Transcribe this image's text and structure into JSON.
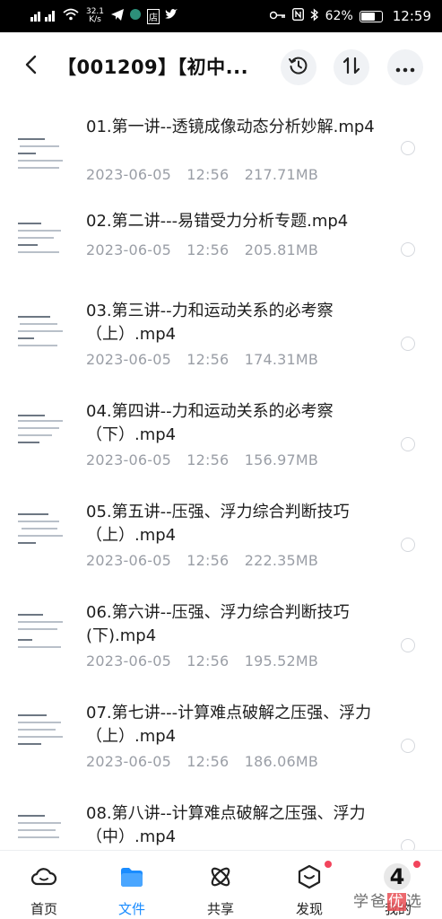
{
  "status_bar": {
    "network_speed": "32.1\nK/s",
    "network_speed_value": "32.1",
    "network_speed_unit": "K/s",
    "app_badge": "店",
    "battery": "62%",
    "time": "12:59"
  },
  "header": {
    "title": "【001209】【初中...",
    "icons": [
      "back-arrow-icon",
      "history-icon",
      "sort-icon",
      "more-icon"
    ]
  },
  "files": [
    {
      "name": "01.第一讲--透镜成像动态分析妙解.mp4",
      "date": "2023-06-05",
      "time": "12:56",
      "size": "217.71MB"
    },
    {
      "name": "02.第二讲---易错受力分析专题.mp4",
      "date": "2023-06-05",
      "time": "12:56",
      "size": "205.81MB"
    },
    {
      "name": "03.第三讲--力和运动关系的必考察（上）.mp4",
      "date": "2023-06-05",
      "time": "12:56",
      "size": "174.31MB"
    },
    {
      "name": "04.第四讲--力和运动关系的必考察（下）.mp4",
      "date": "2023-06-05",
      "time": "12:56",
      "size": "156.97MB"
    },
    {
      "name": "05.第五讲--压强、浮力综合判断技巧（上）.mp4",
      "date": "2023-06-05",
      "time": "12:56",
      "size": "222.35MB"
    },
    {
      "name": "06.第六讲--压强、浮力综合判断技巧(下).mp4",
      "date": "2023-06-05",
      "time": "12:56",
      "size": "195.52MB"
    },
    {
      "name": "07.第七讲---计算难点破解之压强、浮力（上）.mp4",
      "date": "2023-06-05",
      "time": "12:56",
      "size": "186.06MB"
    },
    {
      "name": "08.第八讲--计算难点破解之压强、浮力（中）.mp4",
      "date": "",
      "time": "",
      "size": ""
    }
  ],
  "bottom_nav": [
    {
      "label": "首页",
      "icon": "cloud-icon",
      "active": false,
      "dot": false
    },
    {
      "label": "文件",
      "icon": "folder-icon",
      "active": true,
      "dot": false
    },
    {
      "label": "共享",
      "icon": "share-atom-icon",
      "active": false,
      "dot": false
    },
    {
      "label": "发现",
      "icon": "discover-icon",
      "active": false,
      "dot": true
    },
    {
      "label": "我的",
      "icon": "profile-icon",
      "active": false,
      "dot": true
    }
  ],
  "watermark": {
    "text_a": "学爸",
    "text_b": "优",
    "text_c": "选",
    "badge": "4"
  },
  "colors": {
    "accent": "#1a8cff",
    "meta": "#9a9ea6",
    "dot": "#f2445c"
  }
}
